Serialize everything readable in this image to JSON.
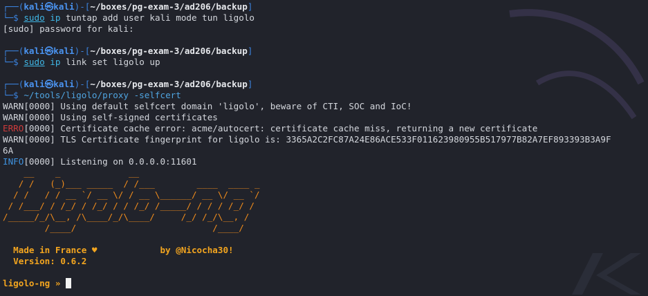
{
  "prompt": {
    "bracket_open": "┌──(",
    "user": "kali",
    "at": "㉿",
    "host": "kali",
    "sep": ")-[",
    "path": "~/boxes/pg-exam-3/ad206/backup",
    "bracket_close": "]",
    "arrow": "└─",
    "dollar": "$ "
  },
  "blocks": [
    {
      "command": "sudo",
      "program": "ip",
      "args": "tuntap add user kali mode tun ligolo",
      "output": [
        "[sudo] password for kali:"
      ]
    },
    {
      "command": "sudo",
      "program": "ip",
      "args": "link set ligolo up",
      "output": []
    },
    {
      "program_path": "~/tools/ligolo/proxy",
      "flag": "-selfcert"
    }
  ],
  "log": [
    {
      "level": "WARN",
      "text": "[0000] Using default selfcert domain 'ligolo', beware of CTI, SOC and IoC!"
    },
    {
      "level": "WARN",
      "text": "[0000] Using self-signed certificates"
    },
    {
      "level": "ERRO",
      "text": "[0000] Certificate cache error: acme/autocert: certificate cache miss, returning a new certificate"
    },
    {
      "level": "WARN",
      "text": "[0000] TLS Certificate fingerprint for ligolo is: 3365A2C2FC87A24E86ACE533F011623980955B517977B82A7EF893393B3A9F"
    },
    {
      "level": "",
      "text": "6A"
    },
    {
      "level": "INFO",
      "text": "[0000] Listening on 0.0.0.0:11601"
    }
  ],
  "banner": {
    "ascii": [
      "    __    _             __",
      "   / /   (_)___ _____  / /___        ____  ____ _",
      "  / /   / / __ `/ __ \\/ / __ \\______/ __ \\/ __ `/",
      " / /___/ / /_/ / /_/ / / /_/ /_____/ / / / /_/ /",
      "/_____/_/\\__, /\\____/_/\\____/     /_/ /_/\\__, /",
      "        /____/                          /____/"
    ],
    "made_in": "  Made in France ♥            by @Nicocha30!",
    "version": "  Version: 0.6.2"
  },
  "repl": {
    "prompt": "ligolo-ng » "
  },
  "colors": {
    "background": "#21232b",
    "prompt_blue": "#3a82dd",
    "command_cyan": "#3fb7e6",
    "error_red": "#cf3b3b",
    "banner_orange": "#f08c1c"
  }
}
